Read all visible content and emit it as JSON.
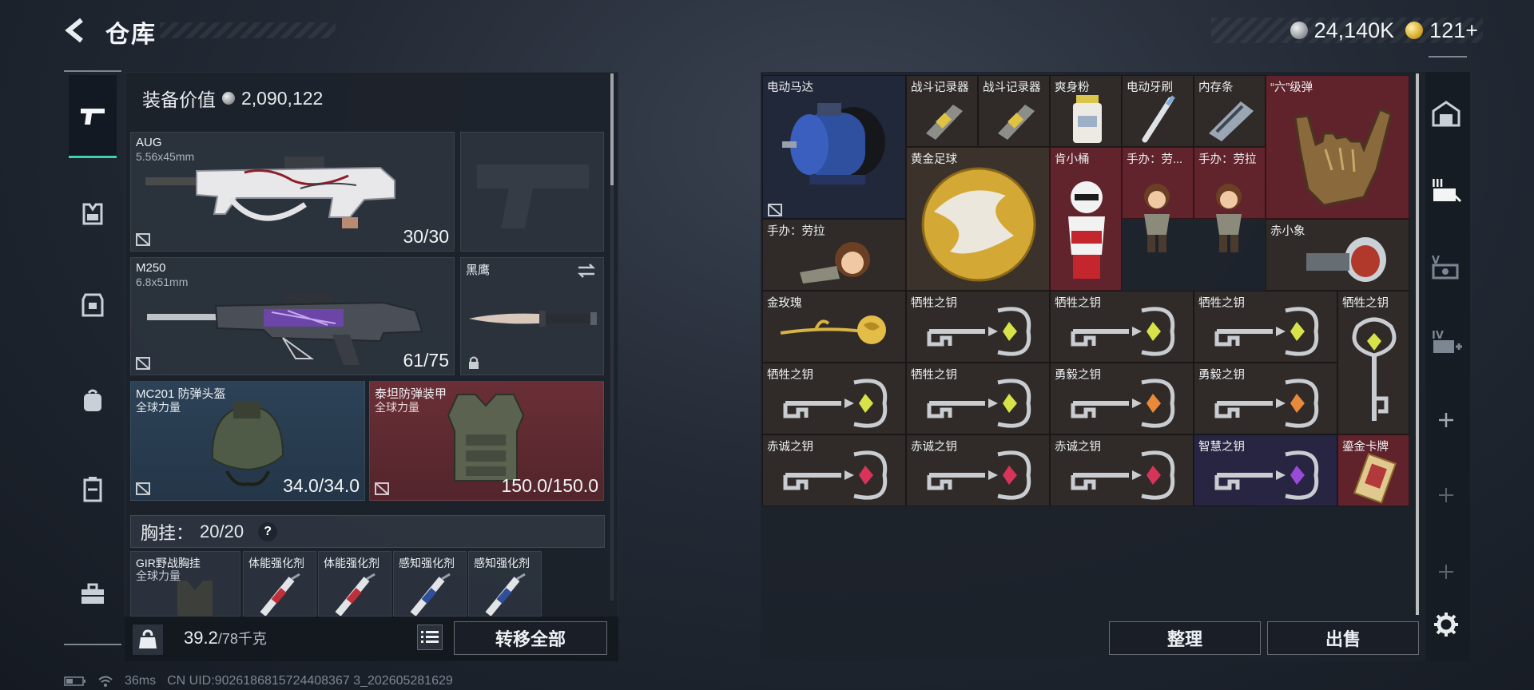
{
  "header": {
    "title": "仓库",
    "currency": {
      "coin": "24,140K",
      "gold": "121+"
    }
  },
  "equipment": {
    "value_label": "装备价值",
    "value": "2,090,122",
    "primary1": {
      "name": "AUG",
      "ammo": "5.56x45mm",
      "count": "30/30"
    },
    "primary2": {
      "name": "M250",
      "ammo": "6.8x51mm",
      "count": "61/75"
    },
    "melee": {
      "name": "黑鹰"
    },
    "helmet": {
      "name": "MC201 防弹头盔",
      "faction": "全球力量",
      "durability": "34.0/34.0"
    },
    "armor": {
      "name": "泰坦防弹装甲",
      "faction": "全球力量",
      "durability": "150.0/150.0"
    },
    "vest": {
      "label": "胸挂：",
      "capacity": "20/20",
      "help": "?",
      "item": {
        "name": "GIR野战胸挂",
        "faction": "全球力量"
      },
      "contents": [
        "体能强化剂",
        "体能强化剂",
        "感知强化剂",
        "感知强化剂"
      ]
    },
    "weight": {
      "value": "39.2",
      "max": "/78千克"
    },
    "transfer_all": "转移全部"
  },
  "storage": {
    "items": [
      {
        "name": "电动马达",
        "color": "#2b3044"
      },
      {
        "name": "战斗记录器",
        "color": "#352f2a"
      },
      {
        "name": "战斗记录器",
        "color": "#352f2a"
      },
      {
        "name": "爽身粉",
        "color": "#352f2a"
      },
      {
        "name": "电动牙刷",
        "color": "#352f2a"
      },
      {
        "name": "内存条",
        "color": "#352f2a"
      },
      {
        "name": "“六”级弹",
        "color": "#6a2730"
      },
      {
        "name": "黄金足球",
        "color": "#3b322b"
      },
      {
        "name": "肯小桶",
        "color": "#6a2730"
      },
      {
        "name": "手办：劳...",
        "color": "#6a2730"
      },
      {
        "name": "手办：劳拉",
        "color": "#6a2730"
      },
      {
        "name": "手办：劳拉",
        "color": "#3b322b"
      },
      {
        "name": "赤小象",
        "color": "#3b322b"
      },
      {
        "name": "金玫瑰",
        "color": "#3b322b"
      },
      {
        "name": "牺牲之钥",
        "color": "#3b322b"
      },
      {
        "name": "牺牲之钥",
        "color": "#3b322b"
      },
      {
        "name": "牺牲之钥",
        "color": "#3b322b"
      },
      {
        "name": "牺牲之钥",
        "color": "#3b322b"
      },
      {
        "name": "牺牲之钥",
        "color": "#3b322b"
      },
      {
        "name": "牺牲之钥",
        "color": "#3b322b"
      },
      {
        "name": "勇毅之钥",
        "color": "#3b322b"
      },
      {
        "name": "勇毅之钥",
        "color": "#3b322b"
      },
      {
        "name": "赤诚之钥",
        "color": "#3b322b"
      },
      {
        "name": "赤诚之钥",
        "color": "#3b322b"
      },
      {
        "name": "赤诚之钥",
        "color": "#3b322b"
      },
      {
        "name": "智慧之钥",
        "color": "#2b2b4a"
      },
      {
        "name": "鎏金卡牌",
        "color": "#6a2730"
      }
    ],
    "sort_label": "整理",
    "sell_label": "出售"
  },
  "status": {
    "ping": "36ms",
    "uid": "CN UID:9026186815724408367 3_202605281629"
  }
}
